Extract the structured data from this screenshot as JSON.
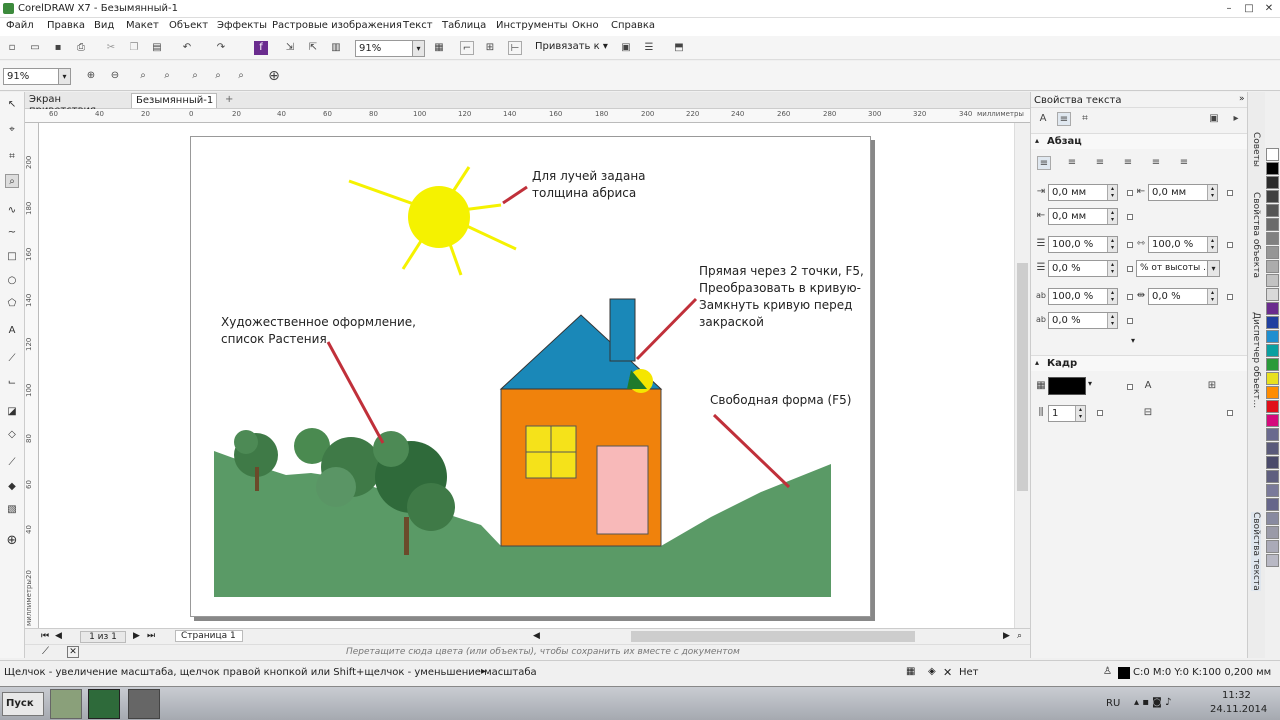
{
  "window": {
    "title": "CorelDRAW X7 - Безымянный-1",
    "min_label": "–",
    "max_label": "□",
    "close_label": "✕"
  },
  "menu": [
    "Файл",
    "Правка",
    "Вид",
    "Макет",
    "Объект",
    "Эффекты",
    "Растровые изображения",
    "Текст",
    "Таблица",
    "Инструменты",
    "Окно",
    "Справка"
  ],
  "toolbar": {
    "zoom_value": "91%",
    "snap_label": "Привязать к",
    "dropdown_caret": "▾"
  },
  "propbar": {
    "zoom_value": "91%"
  },
  "doc_tabs": [
    "Экран приветствия",
    "Безымянный-1"
  ],
  "add_tab_label": "+",
  "ruler": {
    "h_numbers": [
      "60",
      "40",
      "20",
      "0",
      "20",
      "40",
      "60",
      "80",
      "100",
      "120",
      "140",
      "160",
      "180",
      "200",
      "220",
      "240",
      "260",
      "280",
      "300",
      "320",
      "340"
    ],
    "h_unit": "миллиметры",
    "v_numbers": [
      "200",
      "180",
      "160",
      "140",
      "120",
      "100",
      "80",
      "60",
      "40",
      "20"
    ],
    "v_unit": "миллиметры"
  },
  "annotations": {
    "rays": "Для лучей задана\nтолщина абриса",
    "line": "Прямая через 2 точки, F5,\nПреобразовать в кривую-\nЗамкнуть кривую перед\nзакраской",
    "artistic": "Художественное оформление,\nсписок Растения",
    "freeform": "Свободная форма (F5)"
  },
  "pagebar": {
    "counter": "1 из 1",
    "page_tab": "Страница 1"
  },
  "palette_hint": "Перетащите сюда цвета (или объекты), чтобы сохранить их вместе с документом",
  "status": {
    "hint": "Щелчок - увеличение масштаба, щелчок правой кнопкой или Shift+щелчок - уменьшение масштаба",
    "fill_none": "Нет",
    "outline": "C:0 M:0 Y:0 K:100  0,200 мм"
  },
  "docker": {
    "title": "Свойства текста",
    "paragraph_title": "Абзац",
    "fields": {
      "indent_left": "0,0 мм",
      "indent_first": "0,0 мм",
      "indent_right": "0,0 мм",
      "line_spacing": "100,0 %",
      "char_spacing": "100,0 %",
      "before_para": "0,0 %",
      "spacing_unit": "% от высоты ...",
      "word_spacing": "100,0 %",
      "lang_spacing": "0,0 %",
      "after_para": "0,0 %"
    },
    "frame_title": "Кадр",
    "columns": "1"
  },
  "vertical_tabs": [
    "Советы",
    "Свойства объекта",
    "Диспетчер объект...",
    "Свойства текста"
  ],
  "palette_colors": [
    "#ffffff",
    "#000000",
    "#2b2b2b",
    "#3f3f3f",
    "#555555",
    "#6b6b6b",
    "#808080",
    "#969696",
    "#acacac",
    "#c2c2c2",
    "#d9d9d9",
    "#6a2c8e",
    "#1f3f9f",
    "#1f8fd0",
    "#0aa0a0",
    "#2a9a3a",
    "#e8e020",
    "#ff8c00",
    "#e0101a",
    "#d40a7c",
    "#6a6a8e",
    "#5a5a7a",
    "#4a4a6a",
    "#5f5f7f",
    "#7a7a9a",
    "#66668a",
    "#888aa0",
    "#9a9aa8",
    "#aaaab8",
    "#b8b8c4"
  ],
  "taskbar": {
    "start": "Пуск",
    "lang": "RU",
    "time": "11:32",
    "date": "24.11.2014"
  }
}
